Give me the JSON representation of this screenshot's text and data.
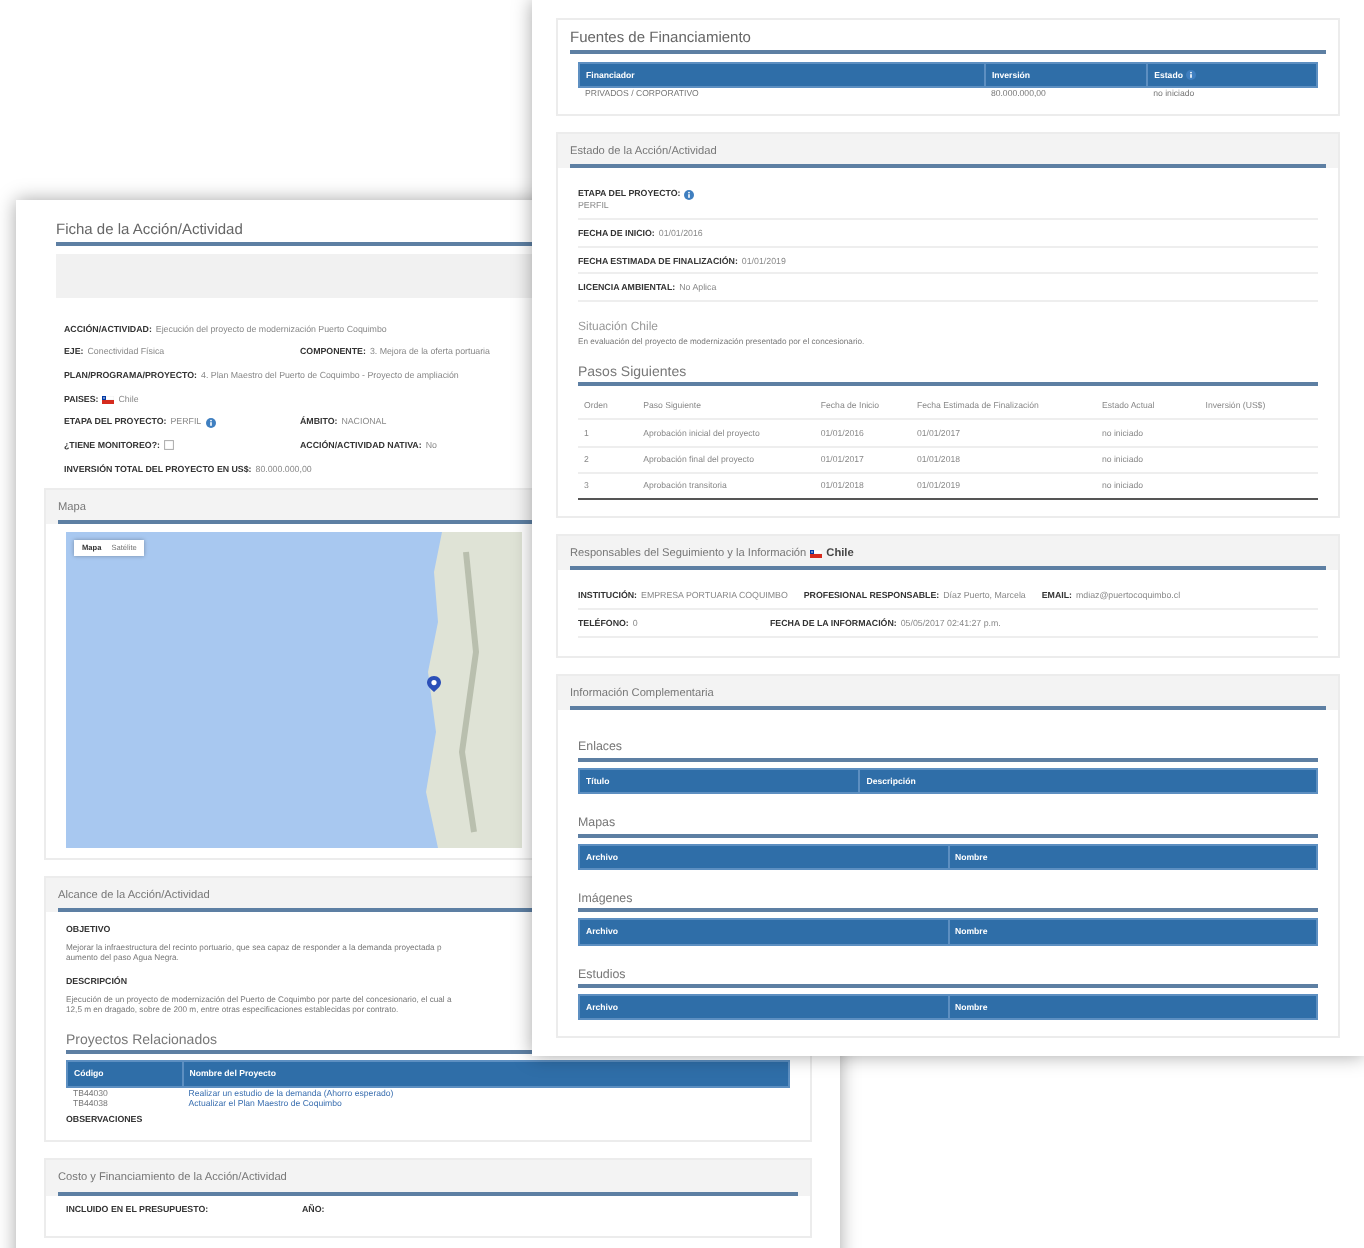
{
  "back_page": {
    "sections": [
      {
        "title": "Ficha de la Acción/Actividad",
        "kind": "plain",
        "items": [
          {
            "kind": "strip"
          },
          {
            "kind": "fields",
            "fields": [
              {
                "kind": "text",
                "label": "ACCIÓN/ACTIVIDAD:",
                "value": "Ejecución del proyecto de modernización Puerto Coquimbo"
              }
            ]
          },
          {
            "kind": "fields",
            "fields": [
              {
                "kind": "text",
                "label": "EJE:",
                "value": "Conectividad Física"
              },
              {
                "kind": "text",
                "label": "COMPONENTE:",
                "value": "3. Mejora de la oferta portuaria"
              }
            ]
          },
          {
            "kind": "fields",
            "fields": [
              {
                "kind": "text",
                "label": "PLAN/PROGRAMA/PROYECTO:",
                "value": "4. Plan Maestro del Puerto de Coquimbo - Proyecto de ampliación"
              }
            ]
          },
          {
            "kind": "fields",
            "fields": [
              {
                "kind": "flag",
                "label": "PAISES:",
                "value": "Chile"
              }
            ]
          },
          {
            "kind": "fields",
            "fields": [
              {
                "kind": "info",
                "label": "ETAPA DEL PROYECTO:",
                "value": "PERFIL"
              },
              {
                "kind": "text",
                "label": "ÁMBITO:",
                "value": "NACIONAL"
              }
            ]
          },
          {
            "kind": "fields",
            "fields": [
              {
                "kind": "checkbox",
                "label": "¿TIENE MONITOREO?:",
                "checked": false
              },
              {
                "kind": "text",
                "label": "ACCIÓN/ACTIVIDAD NATIVA:",
                "value": "No"
              }
            ]
          },
          {
            "kind": "fields",
            "fields": [
              {
                "kind": "text",
                "label": "INVERSIÓN TOTAL DEL PROYECTO EN US$:",
                "value": "80.000.000,00"
              }
            ]
          }
        ]
      },
      {
        "title": "Mapa",
        "kind": "panel",
        "items": [
          {
            "kind": "map",
            "controls": [
              {
                "label": "Mapa",
                "selected": true
              },
              {
                "label": "Satélite",
                "selected": false
              }
            ]
          }
        ]
      },
      {
        "title": "Alcance de la Acción/Actividad",
        "kind": "panel",
        "items": [
          {
            "kind": "paragraph",
            "label": "OBJETIVO",
            "lines": [
              "Mejorar la infraestructura del recinto portuario, que sea capaz de responder a la demanda proyectada p",
              "aumento del paso Agua Negra."
            ]
          },
          {
            "kind": "paragraph",
            "label": "DESCRIPCIÓN",
            "lines": [
              "Ejecución de un proyecto de modernización del Puerto de Coquimbo por parte del concesionario, el cual a",
              "12,5 m en dragado, sobre de 200 m, entre otras especificaciones establecidas por contrato."
            ]
          },
          {
            "kind": "heading",
            "text": "Proyectos Relacionados"
          },
          {
            "kind": "table",
            "columns": [
              {
                "label": "Código",
                "kind": "text"
              },
              {
                "label": "Nombre del Proyecto",
                "kind": "link"
              }
            ],
            "rows": [
              [
                "TB44030",
                "Realizar un estudio de la demanda (Ahorro esperado)"
              ],
              [
                "TB44038",
                "Actualizar el Plan Maestro de Coquimbo"
              ]
            ]
          },
          {
            "kind": "paragraph",
            "label": "OBSERVACIONES"
          }
        ]
      },
      {
        "title": "Costo y Financiamiento de la Acción/Actividad",
        "kind": "panel",
        "items": [
          {
            "kind": "fields",
            "fields": [
              {
                "kind": "text",
                "label": "INCLUIDO EN EL PRESUPUESTO:"
              },
              {
                "kind": "text",
                "label": "AÑO:"
              }
            ]
          }
        ]
      }
    ]
  },
  "front_page": {
    "sections": [
      {
        "title": "Fuentes de Financiamiento",
        "kind": "plain",
        "items": [
          {
            "kind": "table",
            "columns": [
              {
                "label": "Financiador",
                "kind": "text"
              },
              {
                "label": "Inversión",
                "kind": "text"
              },
              {
                "label": "Estado",
                "kind": "info"
              }
            ],
            "rows": [
              [
                "PRIVADOS / CORPORATIVO",
                "80.000.000,00",
                "no iniciado"
              ]
            ]
          }
        ]
      },
      {
        "title": "Estado de la Acción/Actividad",
        "kind": "panel",
        "items": [
          {
            "kind": "fields",
            "fields": [
              {
                "kind": "info_below",
                "label": "ETAPA DEL PROYECTO:",
                "value": "PERFIL"
              }
            ]
          },
          {
            "kind": "fields",
            "fields": [
              {
                "kind": "text",
                "label": "FECHA DE INICIO:",
                "value": "01/01/2016"
              }
            ]
          },
          {
            "kind": "fields",
            "fields": [
              {
                "kind": "text",
                "label": "FECHA ESTIMADA DE FINALIZACIÓN:",
                "value": "01/01/2019"
              }
            ]
          },
          {
            "kind": "fields",
            "fields": [
              {
                "kind": "text",
                "label": "LICENCIA AMBIENTAL:",
                "value": "No Aplica"
              }
            ]
          },
          {
            "kind": "subtitle",
            "text": "Situación Chile"
          },
          {
            "kind": "paragraph",
            "lines": [
              "En evaluación del proyecto de modernización presentado por el concesionario."
            ]
          },
          {
            "kind": "heading",
            "text": "Pasos Siguientes"
          },
          {
            "kind": "list_table",
            "columns": [
              {
                "label": "Orden",
                "kind": "text"
              },
              {
                "label": "Paso Siguiente",
                "kind": "text"
              },
              {
                "label": "Fecha de Inicio",
                "kind": "text"
              },
              {
                "label": "Fecha Estimada de Finalización",
                "kind": "text"
              },
              {
                "label": "Estado Actual",
                "kind": "text"
              },
              {
                "label": "Inversión (US$)",
                "kind": "text"
              }
            ],
            "rows": [
              [
                "1",
                "Aprobación inicial del proyecto",
                "01/01/2016",
                "01/01/2017",
                "no iniciado"
              ],
              [
                "2",
                "Aprobación final del proyecto",
                "01/01/2017",
                "01/01/2018",
                "no iniciado"
              ],
              [
                "3",
                "Aprobación transitoria",
                "01/01/2018",
                "01/01/2019",
                "no iniciado"
              ]
            ]
          }
        ]
      },
      {
        "title": "Responsables del Seguimiento y la Información",
        "kind": "panel",
        "title_country": "Chile",
        "items": [
          {
            "kind": "fields",
            "fields": [
              {
                "kind": "text",
                "label": "INSTITUCIÓN:",
                "value": "EMPRESA PORTUARIA COQUIMBO"
              },
              {
                "kind": "text",
                "label": "PROFESIONAL RESPONSABLE:",
                "value": "Díaz Puerto, Marcela"
              },
              {
                "kind": "text",
                "label": "EMAIL:",
                "value": "mdiaz@puertocoquimbo.cl"
              }
            ]
          },
          {
            "kind": "fields",
            "fields": [
              {
                "kind": "text",
                "label": "TELÉFONO:",
                "value": "0"
              },
              {
                "kind": "text",
                "label": "FECHA DE LA INFORMACIÓN:",
                "value": "05/05/2017 02:41:27 p.m."
              }
            ]
          }
        ]
      },
      {
        "title": "Información Complementaria",
        "kind": "panel",
        "items": [
          {
            "kind": "heading",
            "text": "Enlaces"
          },
          {
            "kind": "table",
            "columns": [
              {
                "label": "Título",
                "kind": "text"
              },
              {
                "label": "Descripción",
                "kind": "text"
              }
            ]
          },
          {
            "kind": "heading",
            "text": "Mapas"
          },
          {
            "kind": "table",
            "columns": [
              {
                "label": "Archivo",
                "kind": "text"
              },
              {
                "label": "Nombre",
                "kind": "text"
              }
            ]
          },
          {
            "kind": "heading",
            "text": "Imágenes"
          },
          {
            "kind": "table",
            "columns": [
              {
                "label": "Archivo",
                "kind": "text"
              },
              {
                "label": "Nombre",
                "kind": "text"
              }
            ]
          },
          {
            "kind": "heading",
            "text": "Estudios"
          },
          {
            "kind": "table",
            "columns": [
              {
                "label": "Archivo",
                "kind": "text"
              },
              {
                "label": "Nombre",
                "kind": "text"
              }
            ]
          }
        ]
      }
    ]
  }
}
